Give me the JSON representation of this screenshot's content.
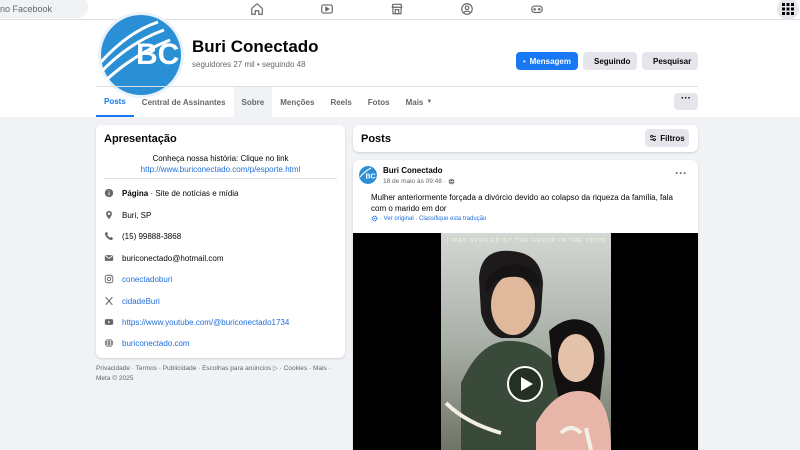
{
  "topbar": {
    "search_placeholder": "no Facebook",
    "nav_icons": [
      "home-icon",
      "video-icon",
      "marketplace-icon",
      "groups-icon",
      "gaming-icon"
    ],
    "menu_icon": "grid-menu-icon"
  },
  "profile": {
    "avatar_text": "BC",
    "name": "Buri Conectado",
    "followers": "seguidores 27 mil • seguindo 48",
    "buttons": {
      "message": "Mensagem",
      "following": "Seguindo",
      "search": "Pesquisar"
    },
    "tabs": [
      "Posts",
      "Central de Assinantes",
      "Sobre",
      "Menções",
      "Reels",
      "Fotos",
      "Mais"
    ],
    "more_label": "···"
  },
  "intro": {
    "title": "Apresentação",
    "bio_text": "Conheça nossa história: Clique no link",
    "bio_link": "http://www.buriconectado.com/p/esporte.html",
    "page_type_label": "Página",
    "page_type_value": " · Site de notícias e mídia",
    "location": "Buri, SP",
    "phone": "(15) 99888-3868",
    "email": "buriconectado@hotmail.com",
    "instagram": "conectadoburi",
    "twitter": "cidadeBuri",
    "youtube": "https://www.youtube.com/@buriconectado1734",
    "website": "buriconectado.com"
  },
  "footer": {
    "text": "Privacidade · Termos · Publicidade · Escolhas para anúncios ▷ · Cookies · Mais · Meta © 2025"
  },
  "posts": {
    "title": "Posts",
    "filter_label": "Filtros",
    "post": {
      "author": "Buri Conectado",
      "time": "18 de maio às 09:48 ·",
      "text": "Mulher anteriormente forçada a divórcio devido ao colapso da riqueza da família, fala com o marido em dor",
      "translation": "· Ver original · Classifique esta tradução",
      "video_caption": "I WAS SPOILED BY THE GROUP IN THE 1970S"
    }
  },
  "colors": {
    "accent": "#1877f2",
    "link": "#216fdb",
    "muted": "#65676b"
  }
}
